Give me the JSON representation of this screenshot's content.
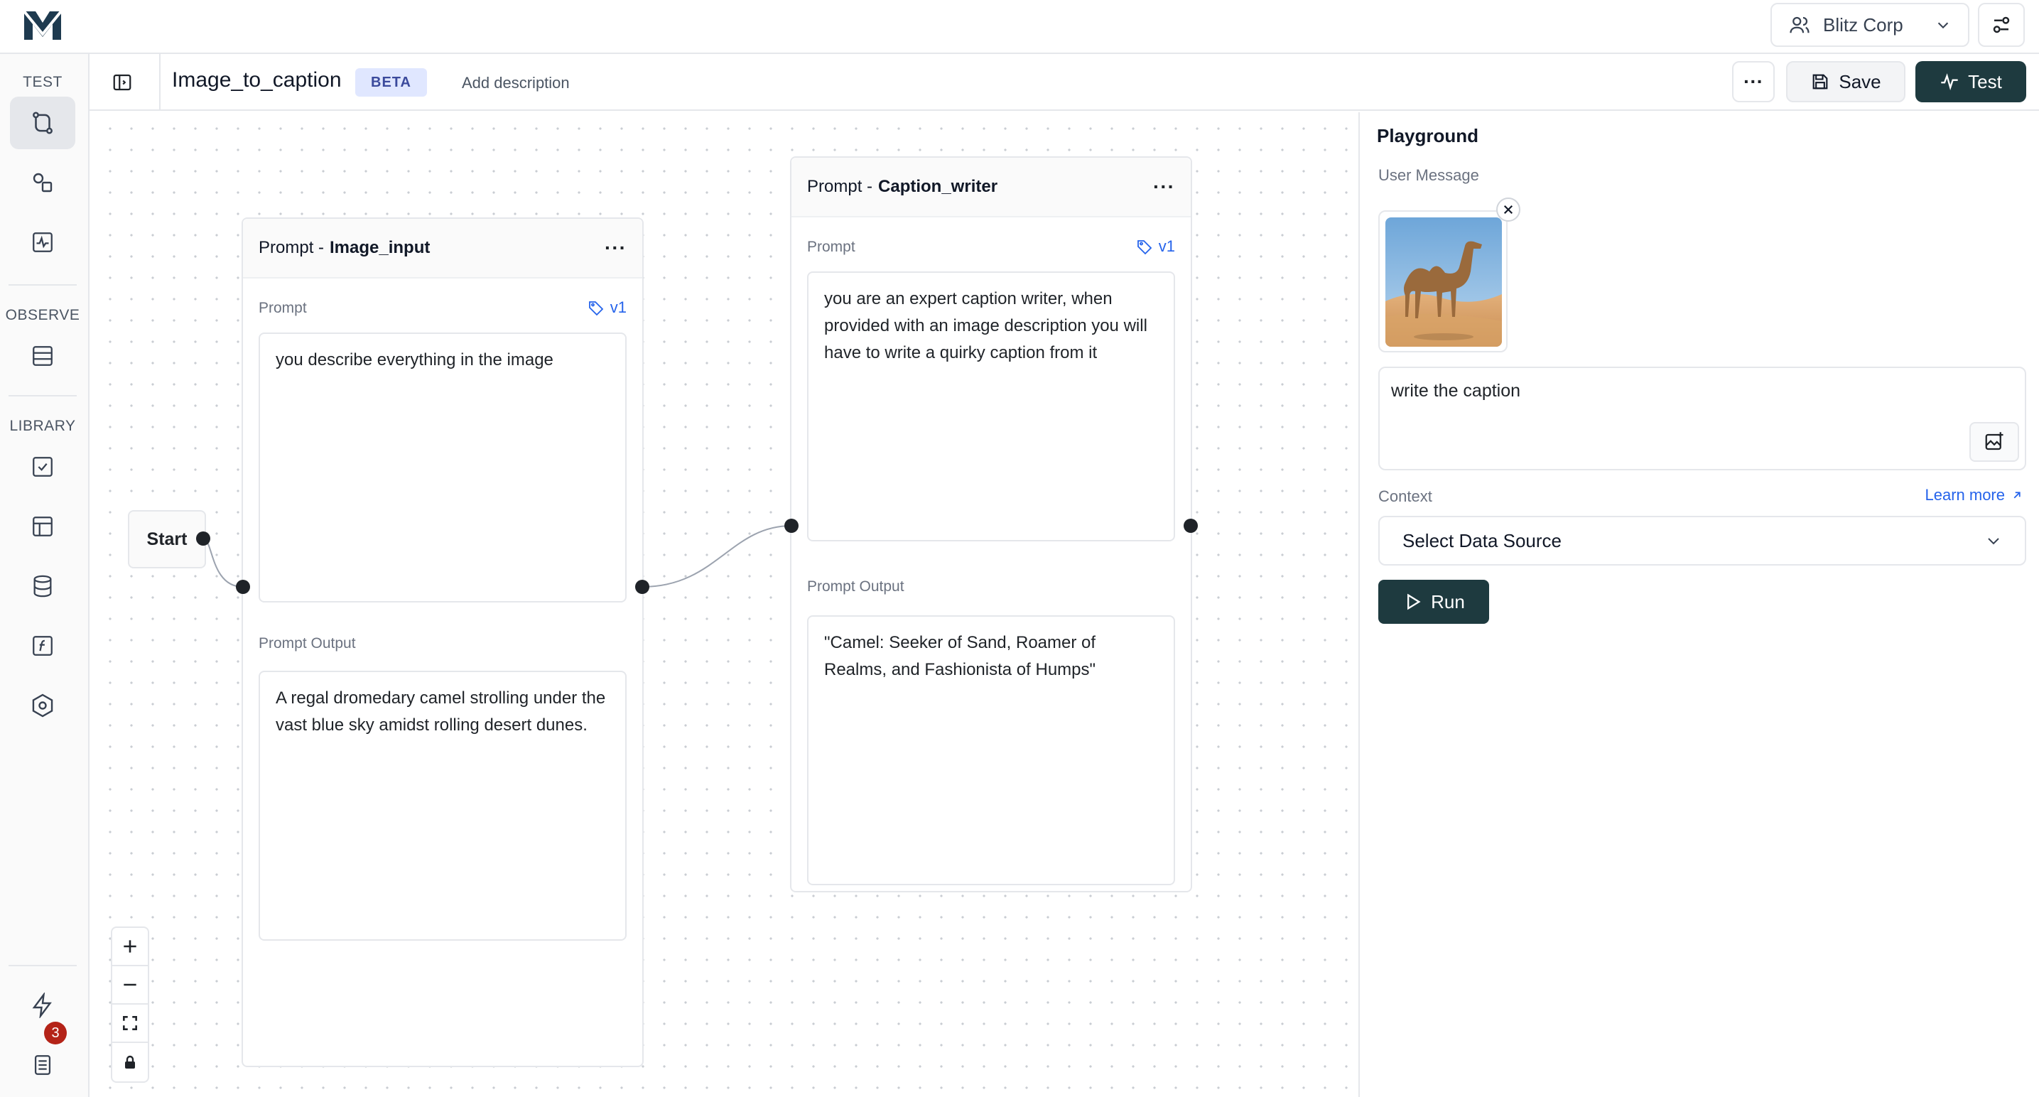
{
  "app": {
    "org_name": "Blitz Corp"
  },
  "sidebar": {
    "sections": [
      {
        "label": "TEST"
      },
      {
        "label": "OBSERVE"
      },
      {
        "label": "LIBRARY"
      }
    ],
    "notification_count": "3"
  },
  "header": {
    "title": "Image_to_caption",
    "badge": "BETA",
    "add_description": "Add description",
    "more_label": "···",
    "save_label": "Save",
    "test_label": "Test"
  },
  "canvas": {
    "start_label": "Start",
    "nodes": [
      {
        "kind": "Prompt - ",
        "name": "Image_input",
        "prompt_label": "Prompt",
        "version": "v1",
        "prompt_text": "you describe everything in the image",
        "output_label": "Prompt Output",
        "output_text": "A regal dromedary camel strolling under the vast blue sky amidst rolling desert dunes."
      },
      {
        "kind": "Prompt - ",
        "name": "Caption_writer",
        "prompt_label": "Prompt",
        "version": "v1",
        "prompt_text": "you are an expert caption writer, when provided with an image description you will have to write a quirky caption from it",
        "output_label": "Prompt Output",
        "output_text": "\"Camel: Seeker of Sand, Roamer of Realms, and Fashionista of Humps\""
      }
    ]
  },
  "playground": {
    "title": "Playground",
    "user_message_label": "User Message",
    "message_text": "write the caption",
    "context_label": "Context",
    "learn_more": "Learn more",
    "data_source_placeholder": "Select Data Source",
    "run_label": "Run"
  },
  "colors": {
    "primary_dark": "#1e3a3f",
    "link_blue": "#2563eb",
    "badge_red": "#b42318",
    "beta_bg": "#e0e7ff"
  },
  "icons": {
    "logo": "brand-logo-icon",
    "org": "users-icon",
    "settings": "sliders-icon",
    "save": "floppy-disk-icon",
    "test": "pulse-icon",
    "tag": "tag-icon",
    "run": "play-icon"
  }
}
